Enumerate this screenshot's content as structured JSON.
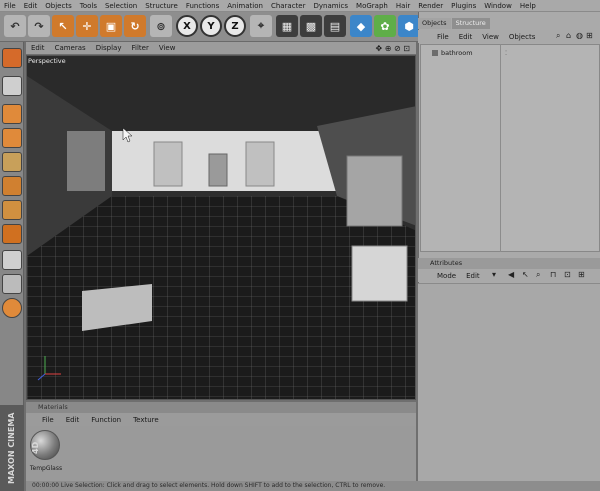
{
  "menubar": {
    "items": [
      "File",
      "Edit",
      "Objects",
      "Tools",
      "Selection",
      "Structure",
      "Functions",
      "Animation",
      "Character",
      "Dynamics",
      "MoGraph",
      "Hair",
      "Render",
      "Plugins",
      "Window",
      "Help"
    ]
  },
  "toolbar": {
    "x_label": "X",
    "y_label": "Y",
    "z_label": "Z"
  },
  "viewport": {
    "menu": [
      "Edit",
      "Cameras",
      "Display",
      "Filter",
      "View"
    ],
    "label": "Perspective",
    "nav_icons": "✥ ⊕ ⊘ ⊡"
  },
  "objects": {
    "tabs": [
      "Objects",
      "Structure"
    ],
    "menu": [
      "File",
      "Edit",
      "View",
      "Objects"
    ],
    "items": [
      {
        "name": "bathroom"
      }
    ]
  },
  "attributes": {
    "tab": "Attributes",
    "menu": [
      "Mode",
      "Edit"
    ]
  },
  "materials": {
    "header": "Materials",
    "menu": [
      "File",
      "Edit",
      "Function",
      "Texture"
    ],
    "item": "TempGlass"
  },
  "brand": {
    "text": "MAXON CINEMA 4D"
  },
  "status": {
    "text": "00:00:00  Live Selection: Click and drag to select elements. Hold down SHIFT to add to the selection, CTRL to remove."
  }
}
